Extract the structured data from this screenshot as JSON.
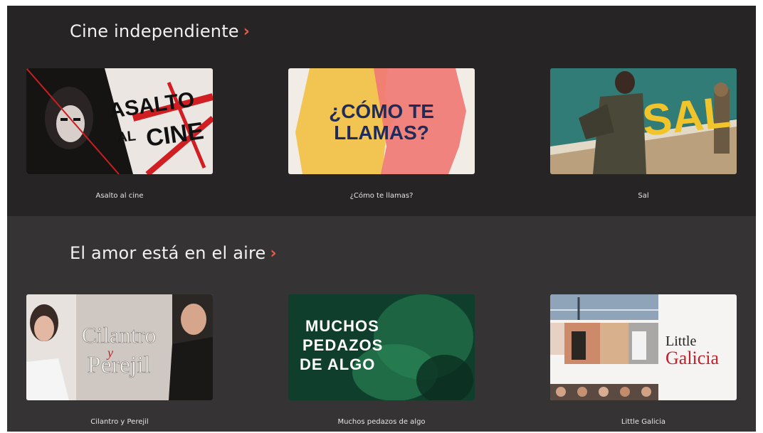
{
  "sections": [
    {
      "title": "Cine independiente",
      "items": [
        {
          "title": "Asalto al cine",
          "poster_text": [
            "ASALTO",
            "AL",
            "CINE"
          ]
        },
        {
          "title": "¿Cómo te llamas?",
          "poster_text": [
            "¿CÓMO TE",
            "LLAMAS?"
          ]
        },
        {
          "title": "Sal",
          "poster_text": [
            "SAL"
          ]
        }
      ]
    },
    {
      "title": "El amor está en el aire",
      "items": [
        {
          "title": "Cilantro y Perejil",
          "poster_text": [
            "Cilantro",
            "y",
            "Perejil"
          ]
        },
        {
          "title": "Muchos pedazos de algo",
          "poster_text": [
            "MUCHOS",
            "PEDAZOS",
            "DE ALGO"
          ]
        },
        {
          "title": "Little Galicia",
          "poster_text": [
            "Little",
            "Galicia"
          ]
        }
      ]
    }
  ],
  "colors": {
    "accent_chevron": "#e85d4d",
    "row1_background": "#262424",
    "row2_background": "#353333"
  },
  "icons": {
    "section_link": "chevron-right-icon"
  }
}
